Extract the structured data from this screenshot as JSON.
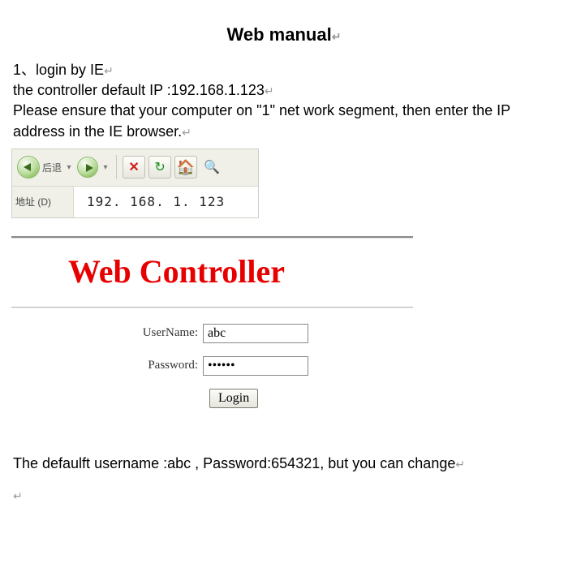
{
  "title": "Web manual",
  "paragraph": {
    "line1": "1、login by IE",
    "line2": "the controller default IP :192.168.1.123",
    "line3": "Please ensure that your computer on \"1\" net work segment, then enter the IP address in the IE browser."
  },
  "ie_toolbar": {
    "back_label": "后退",
    "address_label": "地址 (D)",
    "address_value": "192. 168. 1. 123"
  },
  "login_panel": {
    "heading": "Web Controller",
    "username_label": "UserName:",
    "username_value": "abc",
    "password_label": "Password:",
    "password_value": "••••••",
    "login_button": "Login"
  },
  "footer": {
    "line": "The defaulft username :abc , Password:654321, but you can change"
  }
}
